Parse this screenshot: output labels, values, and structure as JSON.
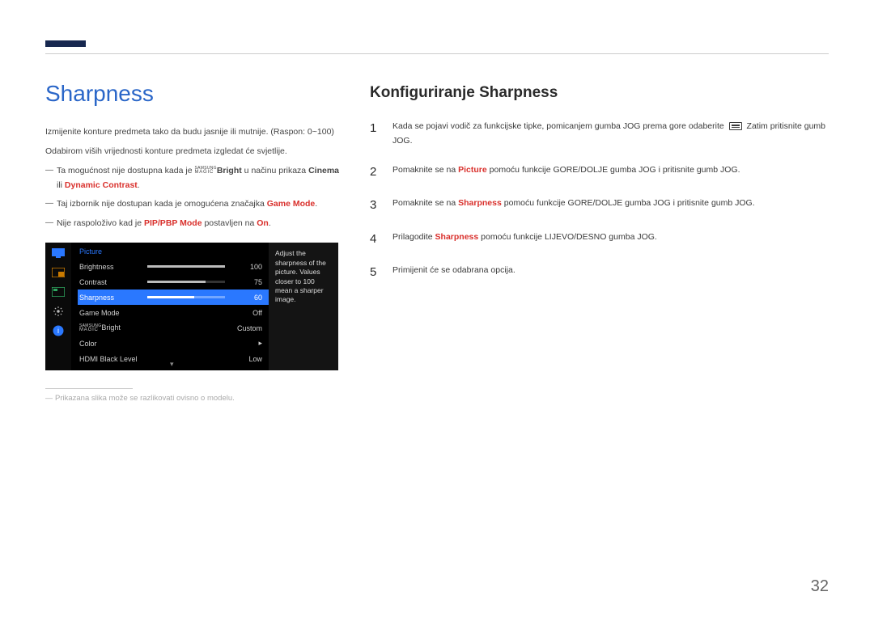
{
  "pageNumber": "32",
  "left": {
    "title": "Sharpness",
    "intro1": "Izmijenite konture predmeta tako da budu jasnije ili mutnije. (Raspon: 0~100)",
    "intro2": "Odabirom viših vrijednosti konture predmeta izgledat će svjetlije.",
    "bullets": {
      "b1_a": "Ta mogućnost nije dostupna kada je ",
      "b1_magic_top": "SAMSUNG",
      "b1_magic_bot": "MAGIC",
      "b1_b": "Bright",
      "b1_c": " u načinu prikaza ",
      "b1_d": "Cinema",
      "b1_e": " ili ",
      "b1_f": "Dynamic Contrast",
      "b1_g": ".",
      "b2_a": "Taj izbornik nije dostupan kada je omogućena značajka ",
      "b2_b": "Game Mode",
      "b2_c": ".",
      "b3_a": "Nije raspoloživo kad je ",
      "b3_b": "PIP/PBP Mode",
      "b3_c": " postavljen na ",
      "b3_d": "On",
      "b3_e": "."
    },
    "osd": {
      "title": "Picture",
      "rows": [
        {
          "label": "Brightness",
          "value": "100",
          "fill": 100,
          "type": "slider"
        },
        {
          "label": "Contrast",
          "value": "75",
          "fill": 75,
          "type": "slider"
        },
        {
          "label": "Sharpness",
          "value": "60",
          "fill": 60,
          "type": "slider",
          "selected": true
        },
        {
          "label": "Game Mode",
          "value": "Off",
          "type": "text"
        },
        {
          "label": "MAGICBright",
          "value": "Custom",
          "type": "magic"
        },
        {
          "label": "Color",
          "value": "▸",
          "type": "text"
        },
        {
          "label": "HDMI Black Level",
          "value": "Low",
          "type": "text"
        }
      ],
      "magic_top": "SAMSUNG",
      "magic_bot": "MAGIC",
      "magic_suffix": "Bright",
      "help": "Adjust the sharpness of the picture. Values closer to 100 mean a sharper image."
    },
    "footnote": "Prikazana slika može se razlikovati ovisno o modelu."
  },
  "right": {
    "title": "Konfiguriranje Sharpness",
    "steps": {
      "s1_a": "Kada se pojavi vodič za funkcijske tipke, pomicanjem gumba JOG prema gore odaberite ",
      "s1_b": " Zatim pritisnite gumb JOG.",
      "s2_a": "Pomaknite se na ",
      "s2_b": "Picture",
      "s2_c": " pomoću funkcije GORE/DOLJE gumba JOG i pritisnite gumb JOG.",
      "s3_a": "Pomaknite se na ",
      "s3_b": "Sharpness",
      "s3_c": " pomoću funkcije GORE/DOLJE gumba JOG i pritisnite gumb JOG.",
      "s4_a": "Prilagodite ",
      "s4_b": "Sharpness",
      "s4_c": " pomoću funkcije LIJEVO/DESNO gumba JOG.",
      "s5": "Primijenit će se odabrana opcija."
    },
    "nums": [
      "1",
      "2",
      "3",
      "4",
      "5"
    ]
  }
}
